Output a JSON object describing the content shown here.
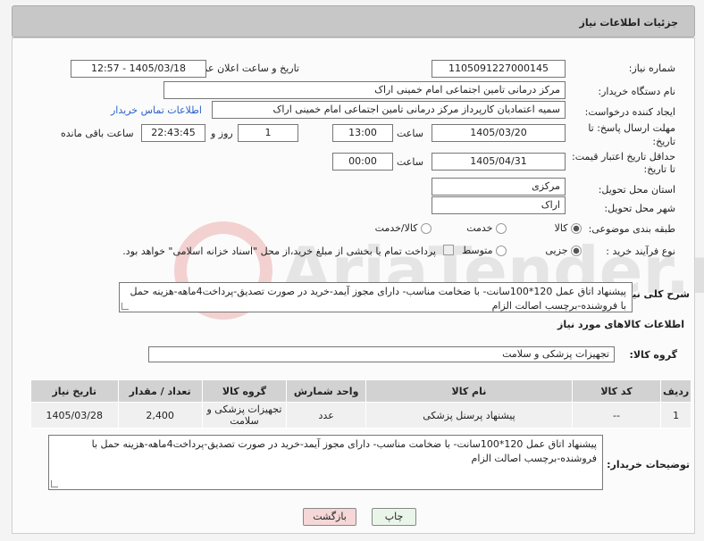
{
  "header": {
    "title": "جزئیات اطلاعات نیاز"
  },
  "form": {
    "need_number_label": "شماره نیاز:",
    "need_number": "1105091227000145",
    "announce_label": "تاریخ و ساعت اعلان عمومی:",
    "announce_value": "1405/03/18 - 12:57",
    "buyer_org_label": "نام دستگاه خریدار:",
    "buyer_org": "مرکز درمانی تامین اجتماعی امام خمینی اراک",
    "creator_label": "ایجاد کننده درخواست:",
    "creator": "سمیه اعتمادیان کارپرداز مرکز درمانی تامین اجتماعی امام خمینی اراک",
    "contact_link": "اطلاعات تماس خریدار",
    "deadline_label_1": "مهلت ارسال پاسخ: تا",
    "deadline_label_2": "تاریخ:",
    "deadline_date": "1405/03/20",
    "time_label": "ساعت",
    "deadline_time": "13:00",
    "days_value": "1",
    "days_label": "روز و",
    "remaining_time": "22:43:45",
    "remaining_label": "ساعت باقی مانده",
    "validity_label_1": "حداقل تاریخ اعتبار قیمت:",
    "validity_label_2": "تا تاریخ:",
    "validity_date": "1405/04/31",
    "validity_time": "00:00",
    "province_label": "استان محل تحویل:",
    "province": "مرکزی",
    "city_label": "شهر محل تحویل:",
    "city": "اراک",
    "category_label": "طبقه بندی موضوعی:",
    "category_options": [
      "کالا",
      "خدمت",
      "کالا/خدمت"
    ],
    "process_label": "نوع فرآیند خرید :",
    "process_options": [
      "جزیی",
      "متوسط"
    ],
    "payment_note": "پرداخت تمام یا بخشی از مبلغ خرید،از محل \"اسناد خزانه اسلامی\" خواهد بود.",
    "description_label": "شرح کلی نیاز:",
    "description": "پیشنهاد اتاق عمل 120*100سانت- با ضخامت مناسب- دارای مجوز آیمد-خرید در صورت تصدیق-پرداخت4ماهه-هزینه حمل با فروشنده-برچسب اصالت الزام",
    "goods_info_title": "اطلاعات کالاهای مورد نیاز",
    "goods_group_label": "گروه کالا:",
    "goods_group": "تجهیزات پزشکی و سلامت"
  },
  "table": {
    "headers": [
      "ردیف",
      "کد کالا",
      "نام کالا",
      "واحد شمارش",
      "گروه کالا",
      "تعداد / مقدار",
      "تاریخ نیاز"
    ],
    "rows": [
      [
        "1",
        "--",
        "پیشنهاد پرسنل پزشکی",
        "عدد",
        "تجهیزات پزشکی و سلامت",
        "2,400",
        "1405/03/28"
      ]
    ]
  },
  "buyer_notes": {
    "label": "توضیحات خریدار:",
    "text": "پیشنهاد اتاق عمل 120*100سانت- با ضخامت مناسب- دارای مجوز آیمد-خرید در صورت تصدیق-پرداخت4ماهه-هزینه حمل با فروشنده-برچسب اصالت الزام"
  },
  "buttons": {
    "print": "چاپ",
    "back": "بازگشت"
  },
  "watermark": "AriaTender.neT",
  "colors": {
    "link": "#2a62c9",
    "header_bg": "#c7c7c7",
    "back_btn": "#f5d7d7",
    "print_btn": "#eaf5ea"
  }
}
